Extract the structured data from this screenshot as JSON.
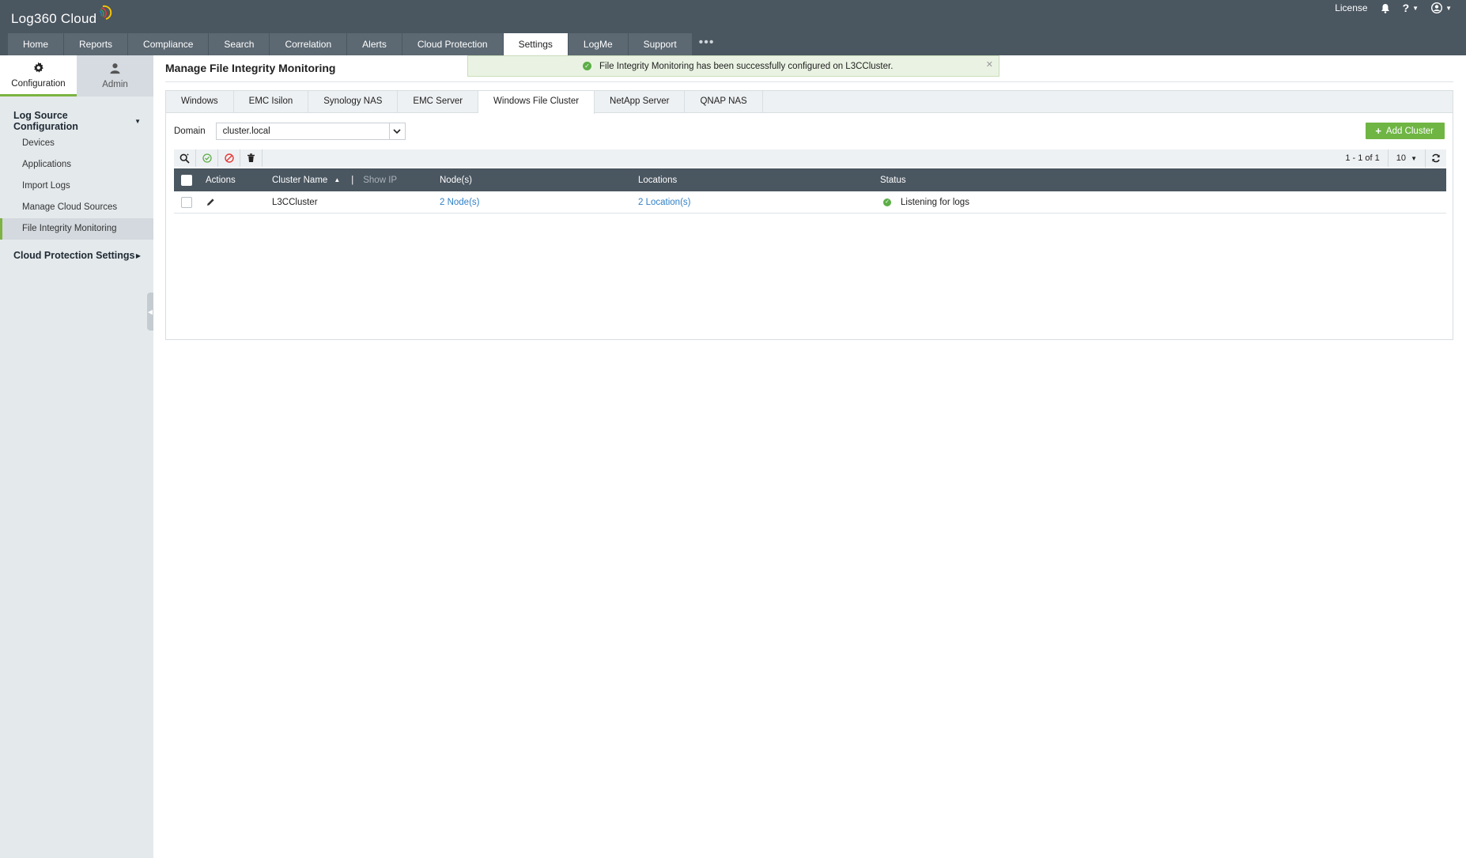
{
  "app": {
    "logo_text": "Log360 Cloud",
    "license_label": "License"
  },
  "nav": {
    "tabs": [
      {
        "label": "Home"
      },
      {
        "label": "Reports"
      },
      {
        "label": "Compliance"
      },
      {
        "label": "Search"
      },
      {
        "label": "Correlation"
      },
      {
        "label": "Alerts"
      },
      {
        "label": "Cloud Protection"
      },
      {
        "label": "Settings",
        "active": true
      },
      {
        "label": "LogMe"
      },
      {
        "label": "Support"
      }
    ],
    "more_label": "•••"
  },
  "sidebar": {
    "tabs": [
      {
        "label": "Configuration",
        "icon": "gear-icon",
        "active": true
      },
      {
        "label": "Admin",
        "icon": "user-icon"
      }
    ],
    "section1": "Log Source Configuration",
    "items": [
      {
        "label": "Devices"
      },
      {
        "label": "Applications"
      },
      {
        "label": "Import Logs"
      },
      {
        "label": "Manage Cloud Sources"
      },
      {
        "label": "File Integrity Monitoring",
        "active": true
      }
    ],
    "section2": "Cloud Protection Settings"
  },
  "page": {
    "title": "Manage File Integrity Monitoring",
    "toast": "File Integrity Monitoring has been successfully configured on L3CCluster.",
    "tabs": [
      {
        "label": "Windows"
      },
      {
        "label": "EMC Isilon"
      },
      {
        "label": "Synology NAS"
      },
      {
        "label": "EMC Server"
      },
      {
        "label": "Windows File Cluster",
        "active": true
      },
      {
        "label": "NetApp Server"
      },
      {
        "label": "QNAP NAS"
      }
    ],
    "domain_label": "Domain",
    "domain_value": "cluster.local",
    "add_button": "Add Cluster",
    "pager": "1 - 1 of 1",
    "per_page": "10"
  },
  "table": {
    "columns": {
      "actions": "Actions",
      "cluster_name": "Cluster Name",
      "show_ip": "Show IP",
      "nodes": "Node(s)",
      "locations": "Locations",
      "status": "Status"
    },
    "rows": [
      {
        "cluster_name": "L3CCluster",
        "nodes": "2 Node(s)",
        "locations": "2 Location(s)",
        "status": "Listening for logs"
      }
    ]
  },
  "colors": {
    "header_bg": "#4a5660",
    "accent_green": "#6fb544",
    "link_blue": "#2f7fc6"
  }
}
